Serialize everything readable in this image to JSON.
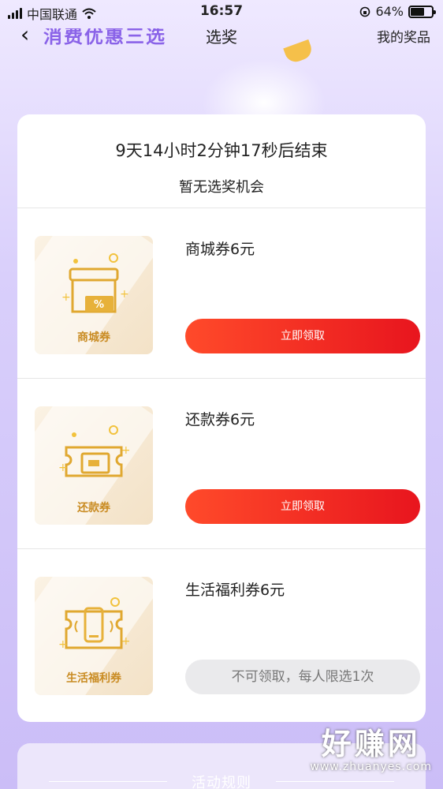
{
  "status_bar": {
    "carrier": "中国联通",
    "time": "16:57",
    "battery": "64%",
    "battery_level": 0.64
  },
  "nav": {
    "title": "选奖",
    "right_link": "我的奖品"
  },
  "countdown": "9天14小时2分钟17秒后结束",
  "chance_text": "暂无选奖机会",
  "prizes": [
    {
      "name": "商城券6元",
      "image_label": "商城券",
      "icon": "store-coupon-icon",
      "button": "立即领取",
      "enabled": true
    },
    {
      "name": "还款券6元",
      "image_label": "还款券",
      "icon": "repayment-coupon-icon",
      "button": "立即领取",
      "enabled": true
    },
    {
      "name": "生活福利券6元",
      "image_label": "生活福利券",
      "icon": "phone-coupon-icon",
      "button": "不可领取，每人限选1次",
      "enabled": false
    }
  ],
  "rules_title": "活动规则",
  "watermark": {
    "text": "好赚网",
    "url": "www.zhuanyes.com"
  },
  "colors": {
    "accent_red": "#e8151e",
    "gold": "#c98b22",
    "background_purple": "#cbbdf7"
  }
}
